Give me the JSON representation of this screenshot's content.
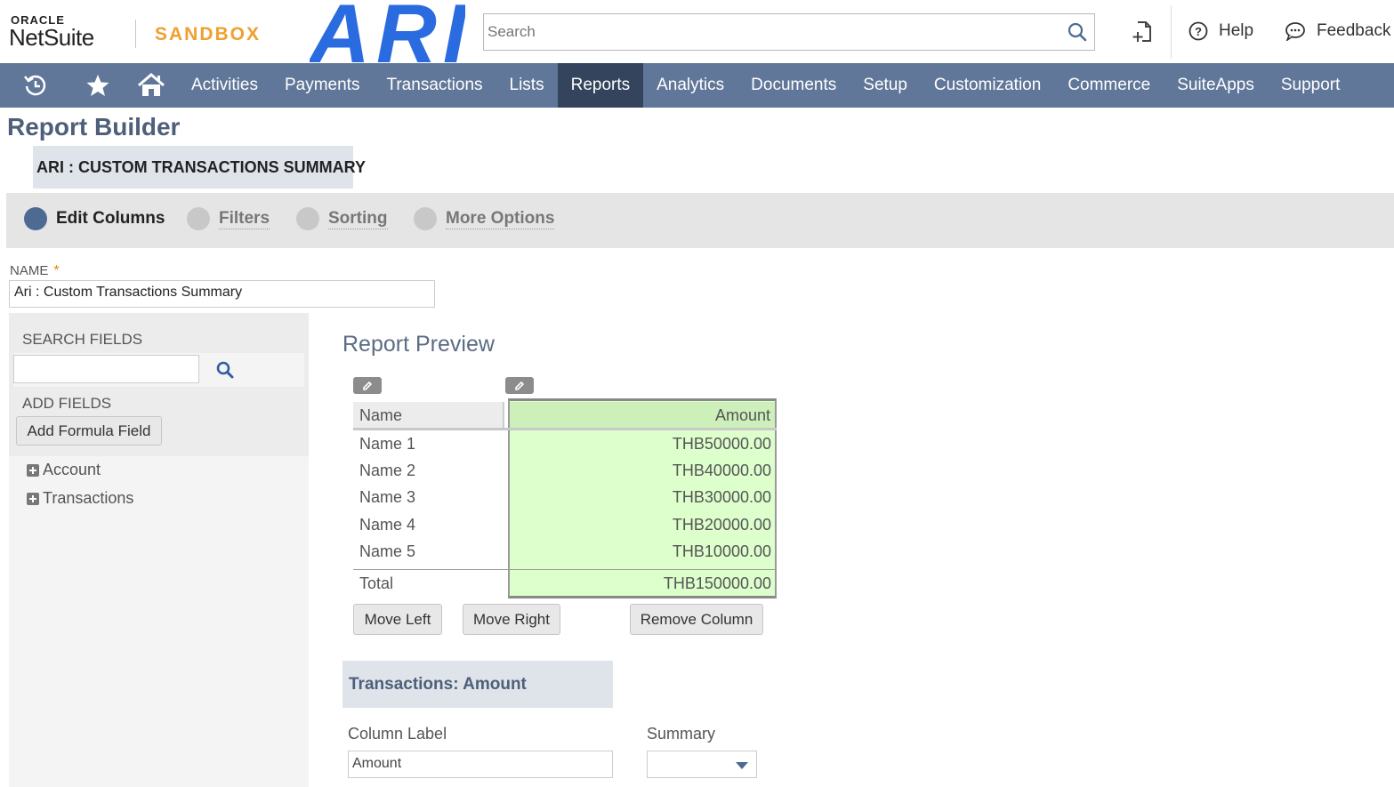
{
  "header": {
    "oracle_label": "ORACLE",
    "netsuite_label": "NetSuite",
    "sandbox_label": "SANDBOX",
    "ari_logo": "ARI",
    "search_placeholder": "Search",
    "help_label": "Help",
    "feedback_label": "Feedback"
  },
  "nav": {
    "icons": [
      "recent-records-icon",
      "star-icon",
      "home-icon"
    ],
    "items": [
      "Activities",
      "Payments",
      "Transactions",
      "Lists",
      "Reports",
      "Analytics",
      "Documents",
      "Setup",
      "Customization",
      "Commerce",
      "SuiteApps",
      "Support"
    ],
    "active": "Reports"
  },
  "page": {
    "title": "Report Builder",
    "record_title": "ARI : CUSTOM TRANSACTIONS SUMMARY"
  },
  "steps": [
    {
      "label": "Edit Columns",
      "active": true
    },
    {
      "label": "Filters",
      "active": false
    },
    {
      "label": "Sorting",
      "active": false
    },
    {
      "label": "More Options",
      "active": false
    }
  ],
  "name_field": {
    "label": "NAME",
    "required_mark": "*",
    "value": "Ari : Custom Transactions Summary"
  },
  "left_panel": {
    "search_fields_label": "SEARCH FIELDS",
    "search_value": "",
    "add_fields_label": "ADD FIELDS",
    "add_formula_button": "Add Formula Field",
    "tree": [
      "Account",
      "Transactions"
    ]
  },
  "preview": {
    "title": "Report Preview",
    "columns": [
      "Name",
      "Amount"
    ],
    "rows": [
      {
        "name": "Name 1",
        "amount": "THB50000.00"
      },
      {
        "name": "Name 2",
        "amount": "THB40000.00"
      },
      {
        "name": "Name 3",
        "amount": "THB30000.00"
      },
      {
        "name": "Name 4",
        "amount": "THB20000.00"
      },
      {
        "name": "Name 5",
        "amount": "THB10000.00"
      }
    ],
    "total_label": "Total",
    "total_amount": "THB150000.00",
    "move_left": "Move Left",
    "move_right": "Move Right",
    "remove_column": "Remove Column"
  },
  "column_detail": {
    "title": "Transactions: Amount",
    "column_label_label": "Column Label",
    "column_label_value": "Amount",
    "summary_label": "Summary",
    "summary_value": ""
  },
  "colors": {
    "nav_bg": "#607799",
    "nav_active": "#34445d",
    "sandbox": "#f0a030",
    "ari_blue": "#2a6be0",
    "selected_column": "#ddffcc"
  }
}
